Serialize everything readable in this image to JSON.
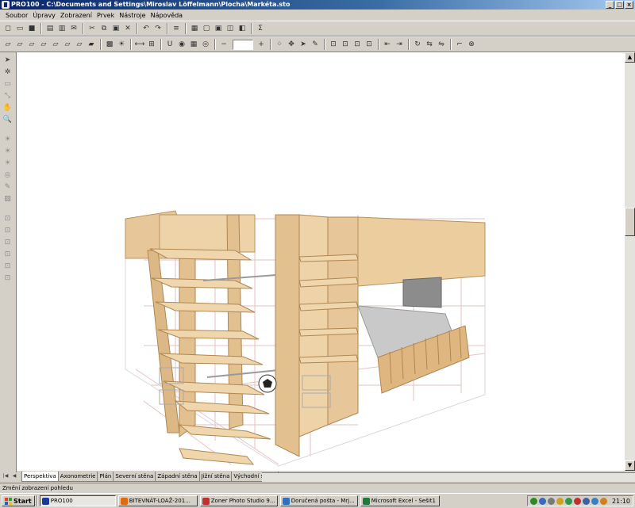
{
  "window": {
    "title": "PRO100 - C:\\Documents and Settings\\Miroslav Löffelmann\\Plocha\\Markéta.sto"
  },
  "menu": [
    "Soubor",
    "Úpravy",
    "Zobrazení",
    "Prvek",
    "Nástroje",
    "Nápověda"
  ],
  "toolbar1": [
    [
      "new-file-icon",
      "◻"
    ],
    [
      "open-folder-icon",
      "▭"
    ],
    [
      "save-icon",
      "■"
    ],
    [
      "sep"
    ],
    [
      "print-preview-icon",
      "▤"
    ],
    [
      "print-icon",
      "▥"
    ],
    [
      "send-icon",
      "✉"
    ],
    [
      "sep"
    ],
    [
      "cut-icon",
      "✂"
    ],
    [
      "copy-icon",
      "⧉"
    ],
    [
      "paste-icon",
      "▣"
    ],
    [
      "delete-icon",
      "✕"
    ],
    [
      "sep"
    ],
    [
      "undo-icon",
      "↶"
    ],
    [
      "redo-icon",
      "↷"
    ],
    [
      "sep"
    ],
    [
      "properties-icon",
      "≡"
    ],
    [
      "sep"
    ],
    [
      "view-list-icon",
      "▦"
    ],
    [
      "view-front-icon",
      "▢"
    ],
    [
      "view-top-icon",
      "▣"
    ],
    [
      "view-side-icon",
      "◫"
    ],
    [
      "render-icon",
      "◧"
    ],
    [
      "sep"
    ],
    [
      "sum-icon",
      "Σ"
    ]
  ],
  "toolbar2": [
    [
      "cube-icon",
      "▱"
    ],
    [
      "cube-open-icon",
      "▱"
    ],
    [
      "cube-left-icon",
      "▱"
    ],
    [
      "cube-right-icon",
      "▱"
    ],
    [
      "cube-back-icon",
      "▱"
    ],
    [
      "cube-front-icon",
      "▱"
    ],
    [
      "cube-top-icon",
      "▱"
    ],
    [
      "cube-color-icon",
      "▰"
    ],
    [
      "sep"
    ],
    [
      "texture-icon",
      "▩"
    ],
    [
      "light-icon",
      "☀"
    ],
    [
      "sep"
    ],
    [
      "measure-icon",
      "⟷"
    ],
    [
      "grid-lines-icon",
      "⊞"
    ],
    [
      "sep"
    ],
    [
      "magnet-icon",
      "U"
    ],
    [
      "globe-icon",
      "◉"
    ],
    [
      "red-grid-icon",
      "▦"
    ],
    [
      "target-icon",
      "◎"
    ],
    [
      "sep"
    ],
    [
      "zoom-out-icon",
      "−"
    ],
    [
      "zoom-in-icon",
      "+"
    ],
    [
      "sep"
    ],
    [
      "grid-dots-icon",
      "⁘"
    ],
    [
      "move-icon",
      "✥"
    ],
    [
      "arrow-select-icon",
      "➤"
    ],
    [
      "pen-icon",
      "✎"
    ],
    [
      "sep"
    ],
    [
      "dim-1-icon",
      "⊡"
    ],
    [
      "dim-2-icon",
      "⊡"
    ],
    [
      "dim-3-icon",
      "⊡"
    ],
    [
      "dim-4-icon",
      "⊡"
    ],
    [
      "sep"
    ],
    [
      "align-left-icon",
      "⇤"
    ],
    [
      "align-right-icon",
      "⇥"
    ],
    [
      "sep"
    ],
    [
      "rotate-icon",
      "↻"
    ],
    [
      "flip-icon",
      "⇆"
    ],
    [
      "mirror-icon",
      "⇋"
    ],
    [
      "sep"
    ],
    [
      "wall-icon",
      "⌐"
    ],
    [
      "stop-icon",
      "⊗"
    ]
  ],
  "lefttools": [
    [
      "select-tool-icon",
      "➤",
      true
    ],
    [
      "rotate-3d-icon",
      "✲",
      true
    ],
    [
      "box-tool-icon",
      "▭",
      false
    ],
    [
      "resize-tool-icon",
      "⤡",
      false
    ],
    [
      "pan-tool-icon",
      "✋",
      false
    ],
    [
      "zoom-tool-icon",
      "🔍",
      false
    ],
    [
      "light-1-icon",
      "☀",
      false
    ],
    [
      "light-2-icon",
      "☀",
      false
    ],
    [
      "light-3-icon",
      "☀",
      false
    ],
    [
      "camera-icon",
      "◎",
      false
    ],
    [
      "brush-icon",
      "✎",
      false
    ],
    [
      "paint-icon",
      "▨",
      false
    ],
    [
      "snap-1-icon",
      "⊡",
      false
    ],
    [
      "snap-2-icon",
      "⊡",
      false
    ],
    [
      "snap-3-icon",
      "⊡",
      false
    ],
    [
      "snap-4-icon",
      "⊡",
      false
    ],
    [
      "snap-5-icon",
      "⊡",
      false
    ],
    [
      "snap-6-icon",
      "⊡",
      false
    ]
  ],
  "tabs": [
    "Perspektiva",
    "Axonometrie",
    "Plán",
    "Severní stěna",
    "Západní stěna",
    "Jižní stěna",
    "Východní stěna"
  ],
  "active_tab": 0,
  "status": "Změní zobrazení pohledu",
  "taskbar": {
    "start": "Start",
    "items": [
      {
        "label": "PRO100",
        "icon": "pro100-icon",
        "color": "#1a3a9a",
        "active": true
      },
      {
        "label": "BITEVNÁT-LOAŽ-201...",
        "icon": "firefox-icon",
        "color": "#e06a10",
        "active": false
      },
      {
        "label": "Zoner Photo Studio 9...",
        "icon": "zoner-icon",
        "color": "#c03030",
        "active": false
      },
      {
        "label": "Doručená pošta - Mrj...",
        "icon": "mail-icon",
        "color": "#3070c0",
        "active": false
      },
      {
        "label": "Microsoft Excel - Sešit1",
        "icon": "excel-icon",
        "color": "#1f7a3a",
        "active": false
      }
    ],
    "tray_icons": [
      {
        "name": "tray-network-icon",
        "color": "#2a8a2a"
      },
      {
        "name": "tray-shield-icon",
        "color": "#3a6ac0"
      },
      {
        "name": "tray-volume-icon",
        "color": "#7a7a7a"
      },
      {
        "name": "tray-update-icon",
        "color": "#d0a020"
      },
      {
        "name": "tray-chat-icon",
        "color": "#2a9a4a"
      },
      {
        "name": "tray-antivirus-icon",
        "color": "#c03030"
      },
      {
        "name": "tray-monitor-icon",
        "color": "#4060a0"
      },
      {
        "name": "tray-globe-icon",
        "color": "#3a80c0"
      },
      {
        "name": "tray-mail-icon",
        "color": "#d08020"
      }
    ],
    "clock": "21:10"
  }
}
